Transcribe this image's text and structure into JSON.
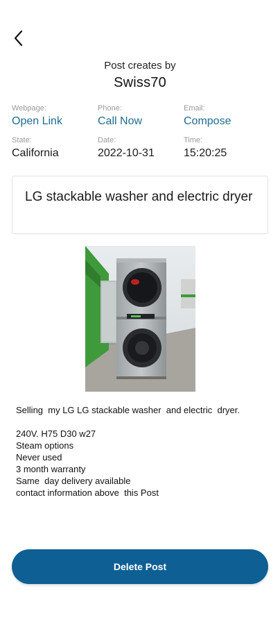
{
  "header": {
    "caption": "Post creates by",
    "author": "Swiss70"
  },
  "info": {
    "webpage": {
      "label": "Webpage:",
      "value": "Open Link"
    },
    "phone": {
      "label": "Phone:",
      "value": "Call Now"
    },
    "email": {
      "label": "Email:",
      "value": "Compose"
    },
    "state": {
      "label": "State:",
      "value": "California"
    },
    "date": {
      "label": "Date:",
      "value": "2022-10-31"
    },
    "time": {
      "label": "Time:",
      "value": "15:20:25"
    }
  },
  "post": {
    "title": "LG stackable washer  and electric dryer",
    "description_lines": [
      "Selling  my LG LG stackable washer  and electric  dryer.",
      "",
      "240V. H75 D30 w27",
      "Steam options",
      "Never used",
      "3 month warranty",
      "Same  day delivery available",
      "contact information above  this Post"
    ]
  },
  "actions": {
    "delete_label": "Delete Post"
  },
  "colors": {
    "link": "#1f6d8f",
    "button": "#0d5f94"
  },
  "icons": {
    "back": "chevron-left-icon"
  }
}
